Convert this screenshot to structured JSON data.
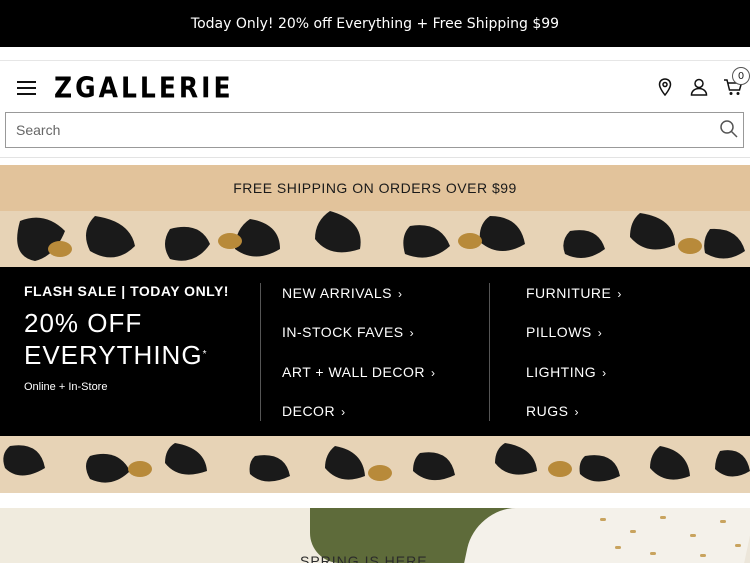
{
  "promo": {
    "text": "Today Only! 20% off Everything + Free Shipping $99"
  },
  "header": {
    "logo": "ZGALLERIE",
    "cart_count": "0",
    "icons": [
      "menu-icon",
      "location-pin-icon",
      "account-icon",
      "cart-icon"
    ]
  },
  "search": {
    "placeholder": "Search",
    "value": ""
  },
  "shipping": {
    "text": "FREE SHIPPING ON ORDERS OVER $99"
  },
  "sale": {
    "flash": "FLASH SALE | TODAY ONLY!",
    "line1": "20% OFF",
    "line2": "EVERYTHING",
    "mark": "*",
    "sub": "Online + In-Store"
  },
  "categories_left": [
    {
      "label": "NEW ARRIVALS"
    },
    {
      "label": "IN-STOCK FAVES"
    },
    {
      "label": "ART + WALL DECOR"
    },
    {
      "label": "DECOR"
    }
  ],
  "categories_right": [
    {
      "label": "FURNITURE"
    },
    {
      "label": "PILLOWS"
    },
    {
      "label": "LIGHTING"
    },
    {
      "label": "RUGS"
    }
  ],
  "arrow": "›",
  "bottom": {
    "heading": "SPRING IS HERE"
  },
  "colors": {
    "black": "#000000",
    "tan": "#e2c39b",
    "leopard_bg": "#e7d3b6"
  }
}
